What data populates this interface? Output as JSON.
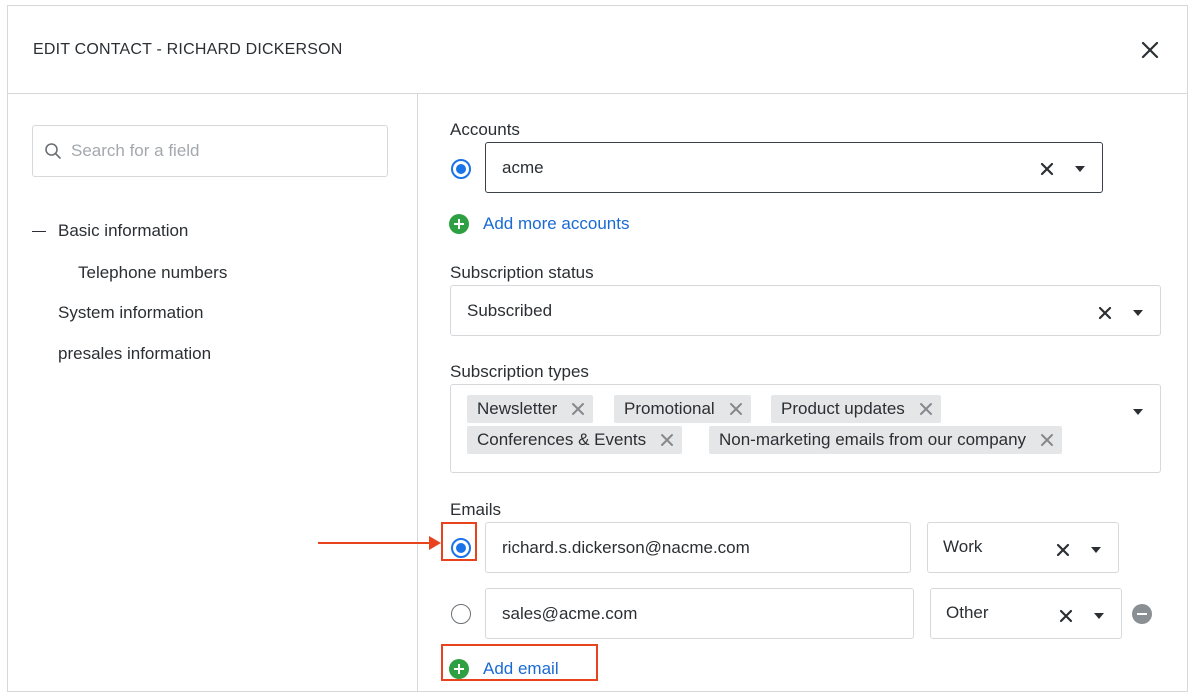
{
  "header": {
    "title": "EDIT CONTACT - RICHARD DICKERSON",
    "close_icon": "close-icon"
  },
  "sidebar": {
    "search": {
      "placeholder": "Search for a field",
      "value": ""
    },
    "items": [
      {
        "label": "Basic information",
        "expanded": true
      },
      {
        "label": "Telephone numbers"
      },
      {
        "label": "System information"
      },
      {
        "label": "presales information"
      }
    ]
  },
  "accounts": {
    "label": "Accounts",
    "value": "acme",
    "add_label": "Add more accounts"
  },
  "subscription_status": {
    "label": "Subscription status",
    "value": "Subscribed"
  },
  "subscription_types": {
    "label": "Subscription types",
    "tags": [
      "Newsletter",
      "Promotional",
      "Product updates",
      "Conferences & Events",
      "Non-marketing emails from our company"
    ]
  },
  "emails": {
    "label": "Emails",
    "rows": [
      {
        "address": "richard.s.dickerson@nacme.com",
        "type": "Work",
        "primary": true
      },
      {
        "address": "sales@acme.com",
        "type": "Other",
        "primary": false
      }
    ],
    "add_label": "Add email"
  },
  "colors": {
    "accent": "#1a73e8",
    "add": "#2ea043",
    "link": "#1a6ad4",
    "annotation": "#e8421e"
  }
}
